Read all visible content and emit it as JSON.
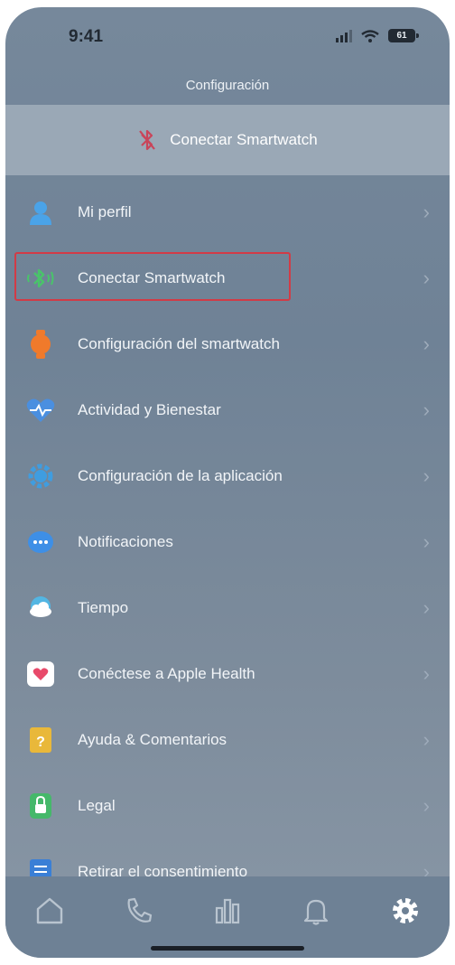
{
  "status_bar": {
    "time": "9:41",
    "battery_level": "61"
  },
  "header": {
    "title": "Configuración"
  },
  "banner": {
    "label": "Conectar Smartwatch",
    "icon": "bluetooth-off-icon"
  },
  "menu": [
    {
      "label": "Mi perfil",
      "icon": "person-icon",
      "color": "#4aa3e8"
    },
    {
      "label": "Conectar Smartwatch",
      "icon": "bluetooth-icon",
      "color": "#49c46a",
      "highlighted": true
    },
    {
      "label": "Configuración del smartwatch",
      "icon": "watch-icon",
      "color": "#f07a2b"
    },
    {
      "label": "Actividad y Bienestar",
      "icon": "heart-pulse-icon",
      "color": "#4a8fe0"
    },
    {
      "label": "Configuración de la aplicación",
      "icon": "gear-icon",
      "color": "#3f9de0"
    },
    {
      "label": "Notificaciones",
      "icon": "message-icon",
      "color": "#3e8fe6"
    },
    {
      "label": "Tiempo",
      "icon": "weather-icon",
      "color": "#53b6e3"
    },
    {
      "label": "Conéctese a Apple Health",
      "icon": "health-icon",
      "color": "#e84a6a"
    },
    {
      "label": "Ayuda & Comentarios",
      "icon": "help-icon",
      "color": "#e9b83a"
    },
    {
      "label": "Legal",
      "icon": "lock-icon",
      "color": "#45b86a"
    },
    {
      "label": "Retirar el consentimiento",
      "icon": "document-icon",
      "color": "#3a7fd6"
    }
  ],
  "tabbar": [
    {
      "name": "home-icon"
    },
    {
      "name": "phone-icon"
    },
    {
      "name": "stats-icon"
    },
    {
      "name": "bell-icon"
    },
    {
      "name": "gear-icon",
      "active": true
    }
  ]
}
